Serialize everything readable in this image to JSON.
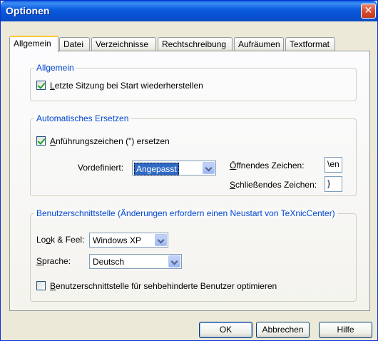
{
  "window": {
    "title": "Optionen",
    "close_symbol": "✕"
  },
  "tabs": [
    {
      "label": "Allgemein",
      "active": true
    },
    {
      "label": "Datei",
      "active": false
    },
    {
      "label": "Verzeichnisse",
      "active": false
    },
    {
      "label": "Rechtschreibung",
      "active": false
    },
    {
      "label": "Aufräumen",
      "active": false
    },
    {
      "label": "Textformat",
      "active": false
    }
  ],
  "group_allgemein": {
    "title": "Allgemein",
    "restore_session": {
      "mnemonic": "L",
      "rest": "etzte Sitzung bei Start wiederherstellen",
      "checked": true
    }
  },
  "group_replace": {
    "title": "Automatisches Ersetzen",
    "quotes": {
      "mnemonic": "A",
      "rest": "nführungszeichen (\") ersetzen",
      "checked": true
    },
    "predefined_label": "Vordefiniert:",
    "predefined_value": "Angepasst",
    "opening": {
      "mnemonic": "Ö",
      "rest": "ffnendes Zeichen:",
      "value": "\\en"
    },
    "closing": {
      "mnemonic": "S",
      "rest": "chließendes Zeichen:",
      "value": "}"
    }
  },
  "group_ui": {
    "title": "Benutzerschnittstelle (Änderungen erfordern einen Neustart von TeXnicCenter)",
    "look": {
      "pre": "Lo",
      "mnemonic": "o",
      "rest": "k & Feel:",
      "value": "Windows XP"
    },
    "language": {
      "mnemonic": "S",
      "rest": "prache:",
      "value": "Deutsch"
    },
    "accessibility": {
      "mnemonic": "B",
      "rest": "enutzerschnittstelle für sehbehinderte Benutzer optimieren",
      "checked": false
    }
  },
  "buttons": {
    "ok": "OK",
    "cancel": "Abbrechen",
    "help": "Hilfe"
  },
  "colors": {
    "titlebar": "#0a5fd8",
    "group_title": "#0046d5",
    "selection": "#316ac5",
    "check": "#21a121"
  }
}
